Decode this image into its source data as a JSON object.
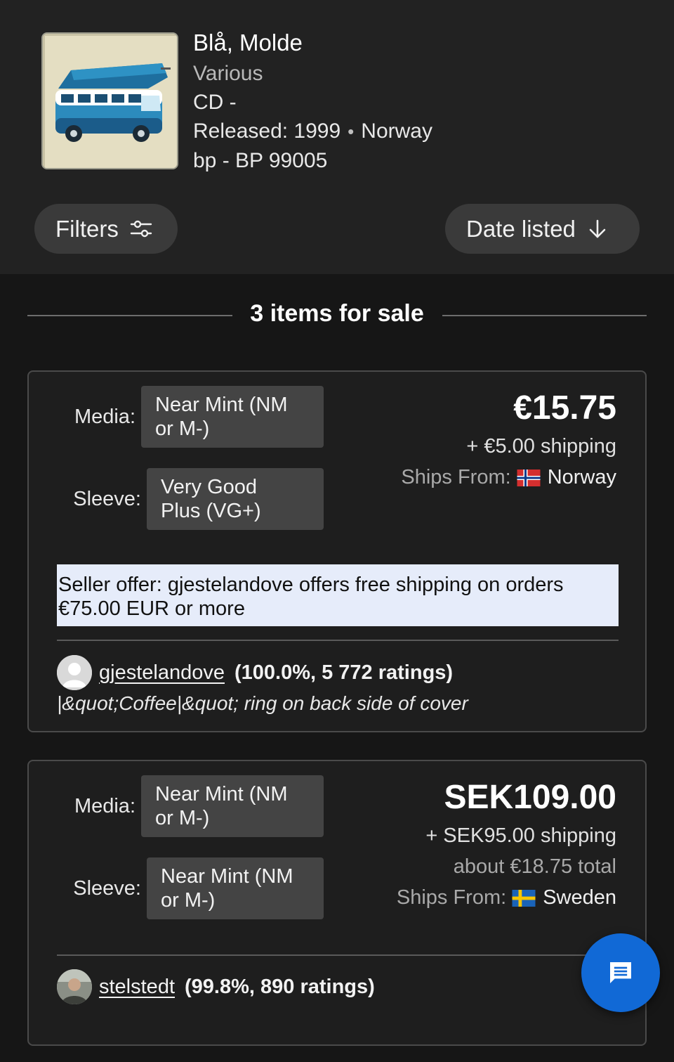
{
  "release": {
    "title": "Blå, Molde",
    "artist": "Various",
    "format": "CD -",
    "released_label": "Released: 1999",
    "country": "Norway",
    "catalog": "bp - BP 99005"
  },
  "controls": {
    "filters_label": "Filters",
    "sort_label": "Date listed"
  },
  "items_heading": "3 items for sale",
  "listings": [
    {
      "media_label": "Media:",
      "media_line1": "Near Mint (NM",
      "media_line2": "or M-)",
      "sleeve_label": "Sleeve:",
      "sleeve_line1": "Very Good",
      "sleeve_line2": "Plus (VG+)",
      "price": "€15.75",
      "shipping": "+ €5.00 shipping",
      "ships_from_label": "Ships From:",
      "ships_from_country": "Norway",
      "seller_offer_line1": "Seller offer: gjestelandove offers free shipping on orders",
      "seller_offer_line2": "€75.00 EUR or more",
      "seller_name": "gjestelandove",
      "seller_stats": "(100.0%, 5 772 ratings)",
      "comment": "|&quot;Coffee|&quot; ring on back side of cover"
    },
    {
      "media_label": "Media:",
      "media_line1": "Near Mint (NM",
      "media_line2": "or M-)",
      "sleeve_label": "Sleeve:",
      "sleeve_line1": "Near Mint (NM",
      "sleeve_line2": "or M-)",
      "price": "SEK109.00",
      "shipping": "+ SEK95.00 shipping",
      "total": "about €18.75 total",
      "ships_from_label": "Ships From:",
      "ships_from_country": "Sweden",
      "seller_name": "stelstedt",
      "seller_stats": "(99.8%, 890 ratings)"
    }
  ],
  "icons": {
    "filters": "sliders-icon",
    "sort": "arrow-down-icon",
    "chat": "chat-icon",
    "flag_norway": "norway-flag-icon",
    "flag_sweden": "sweden-flag-icon"
  },
  "colors": {
    "background": "#161616",
    "header": "#222222",
    "pill": "#3a3a3a",
    "condition_box": "#444444",
    "offer_bg": "#e6ecfa",
    "chat_button": "#1169d6"
  }
}
